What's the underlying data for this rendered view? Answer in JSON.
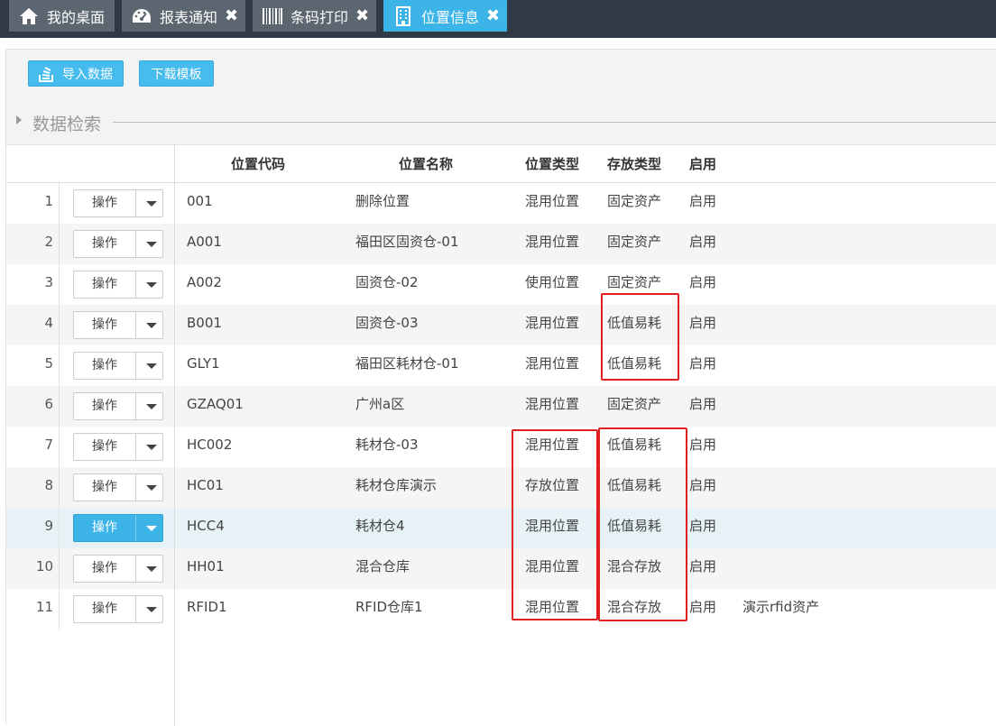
{
  "tabs": [
    {
      "label": "我的桌面",
      "icon": "home-icon",
      "closable": false,
      "active": false
    },
    {
      "label": "报表通知",
      "icon": "dashboard-icon",
      "closable": true,
      "active": false
    },
    {
      "label": "条码打印",
      "icon": "barcode-icon",
      "closable": true,
      "active": false
    },
    {
      "label": "位置信息",
      "icon": "building-icon",
      "closable": true,
      "active": true
    }
  ],
  "toolbar": {
    "import_label": "导入数据",
    "template_label": "下载模板"
  },
  "search": {
    "title": "数据检索"
  },
  "table": {
    "columns": [
      "位置代码",
      "位置名称",
      "位置类型",
      "存放类型",
      "启用"
    ],
    "op_label": "操作",
    "rows": [
      {
        "num": "1",
        "code": "001",
        "name": "删除位置",
        "loc_type": "混用位置",
        "store_type": "固定资产",
        "enabled": "启用",
        "note": ""
      },
      {
        "num": "2",
        "code": "A001",
        "name": "福田区固资仓-01",
        "loc_type": "混用位置",
        "store_type": "固定资产",
        "enabled": "启用",
        "note": ""
      },
      {
        "num": "3",
        "code": "A002",
        "name": "固资仓-02",
        "loc_type": "使用位置",
        "store_type": "固定资产",
        "enabled": "启用",
        "note": ""
      },
      {
        "num": "4",
        "code": "B001",
        "name": "固资仓-03",
        "loc_type": "混用位置",
        "store_type": "低值易耗",
        "enabled": "启用",
        "note": ""
      },
      {
        "num": "5",
        "code": "GLY1",
        "name": "福田区耗材仓-01",
        "loc_type": "混用位置",
        "store_type": "低值易耗",
        "enabled": "启用",
        "note": ""
      },
      {
        "num": "6",
        "code": "GZAQ01",
        "name": "广州a区",
        "loc_type": "混用位置",
        "store_type": "固定资产",
        "enabled": "启用",
        "note": ""
      },
      {
        "num": "7",
        "code": "HC002",
        "name": "耗材仓-03",
        "loc_type": "混用位置",
        "store_type": "低值易耗",
        "enabled": "启用",
        "note": ""
      },
      {
        "num": "8",
        "code": "HC01",
        "name": "耗材仓库演示",
        "loc_type": "存放位置",
        "store_type": "低值易耗",
        "enabled": "启用",
        "note": ""
      },
      {
        "num": "9",
        "code": "HCC4",
        "name": "耗材仓4",
        "loc_type": "混用位置",
        "store_type": "低值易耗",
        "enabled": "启用",
        "note": ""
      },
      {
        "num": "10",
        "code": "HH01",
        "name": "混合仓库",
        "loc_type": "混用位置",
        "store_type": "混合存放",
        "enabled": "启用",
        "note": ""
      },
      {
        "num": "11",
        "code": "RFID1",
        "name": "RFID仓库1",
        "loc_type": "混用位置",
        "store_type": "混合存放",
        "enabled": "启用",
        "note": "演示rfid资产"
      }
    ],
    "selected_row": 9
  },
  "colors": {
    "accent": "#3cb4e8",
    "topbar": "#2f3a46",
    "tab_inactive": "#5c6670",
    "highlight": "#e02020"
  }
}
